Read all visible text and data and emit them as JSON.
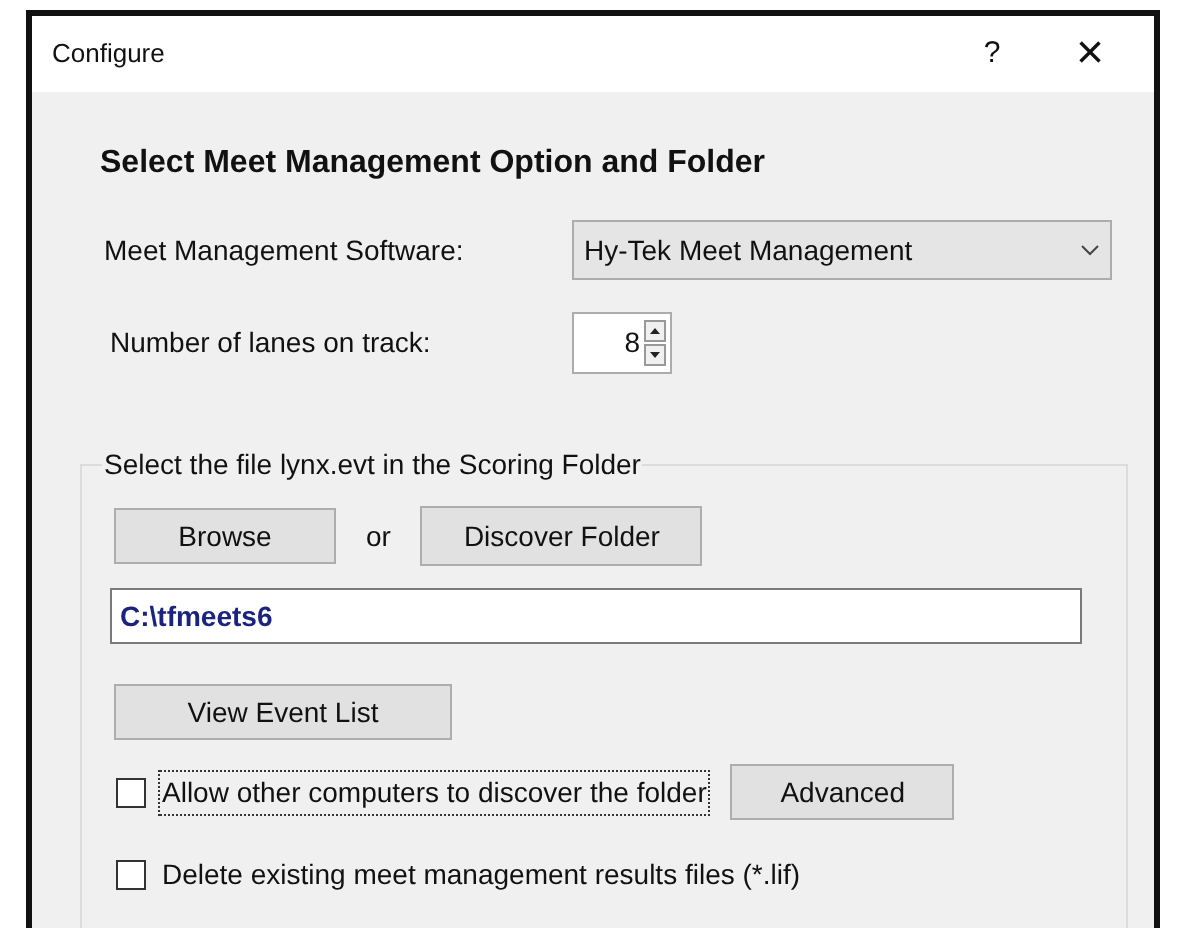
{
  "window": {
    "title": "Configure",
    "help": "?",
    "close": "×"
  },
  "heading": "Select Meet Management Option and Folder",
  "software": {
    "label": "Meet Management Software:",
    "value": "Hy-Tek Meet Management"
  },
  "lanes": {
    "label": "Number of lanes on track:",
    "value": "8"
  },
  "group": {
    "title": "Select the file lynx.evt in the Scoring Folder",
    "browse": "Browse",
    "or": "or",
    "discover": "Discover Folder",
    "folder": "C:\\tfmeets6",
    "view_events": "View Event List"
  },
  "options": [
    {
      "label": "Allow other computers to discover the folder",
      "checked": false,
      "focused": true,
      "button": "Advanced"
    },
    {
      "label": "Delete existing meet management results files (*.lif)",
      "checked": false,
      "focused": false
    }
  ]
}
